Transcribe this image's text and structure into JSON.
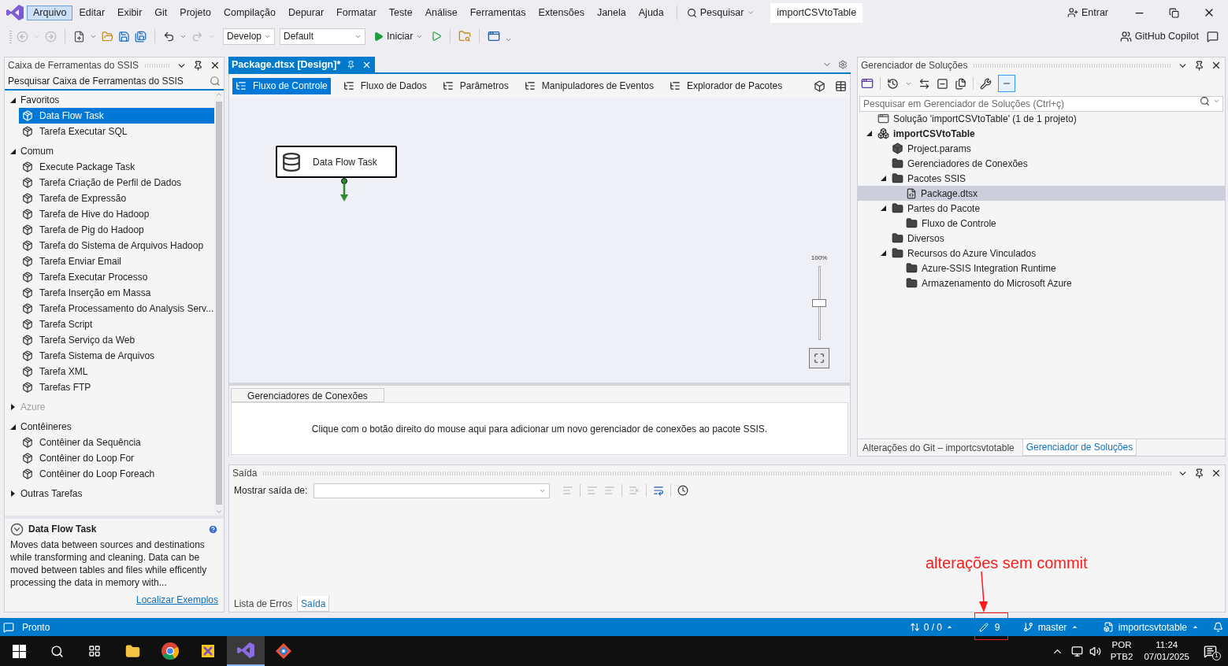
{
  "menu_bar": {
    "items": [
      {
        "label": "Arquivo",
        "selected": true
      },
      {
        "label": "Editar",
        "selected": false
      },
      {
        "label": "Exibir",
        "selected": false
      },
      {
        "label": "Git",
        "selected": false
      },
      {
        "label": "Projeto",
        "selected": false
      },
      {
        "label": "Compilação",
        "selected": false
      },
      {
        "label": "Depurar",
        "selected": false
      },
      {
        "label": "Formatar",
        "selected": false
      },
      {
        "label": "Teste",
        "selected": false
      },
      {
        "label": "Análise",
        "selected": false
      },
      {
        "label": "Ferramentas",
        "selected": false
      },
      {
        "label": "Extensões",
        "selected": false
      },
      {
        "label": "Janela",
        "selected": false
      },
      {
        "label": "Ajuda",
        "selected": false
      }
    ],
    "search": "Pesquisar",
    "solution_name": "importCSVtoTable",
    "sign_in": "Entrar"
  },
  "toolbar": {
    "configuration": "Develop",
    "platform": "Default",
    "start": "Iniciar",
    "copilot": "GitHub Copilot"
  },
  "toolbox": {
    "title": "Caixa de Ferramentas do SSIS",
    "search_placeholder": "Pesquisar Caixa de Ferramentas do SSIS",
    "groups": [
      {
        "label": "Favoritos",
        "expanded": true,
        "disabled": false,
        "children": [
          {
            "label": "Data Flow Task",
            "selected": true
          },
          {
            "label": "Tarefa Executar SQL",
            "selected": false
          }
        ]
      },
      {
        "label": "Comum",
        "expanded": true,
        "disabled": false,
        "children": [
          {
            "label": "Execute Package Task",
            "selected": false
          },
          {
            "label": "Tarefa Criação de Perfil de Dados",
            "selected": false
          },
          {
            "label": "Tarefa de Expressão",
            "selected": false
          },
          {
            "label": "Tarefa de Hive do Hadoop",
            "selected": false
          },
          {
            "label": "Tarefa de Pig do Hadoop",
            "selected": false
          },
          {
            "label": "Tarefa do Sistema de Arquivos Hadoop",
            "selected": false
          },
          {
            "label": "Tarefa Enviar Email",
            "selected": false
          },
          {
            "label": "Tarefa Executar Processo",
            "selected": false
          },
          {
            "label": "Tarefa Inserção em Massa",
            "selected": false
          },
          {
            "label": "Tarefa Processamento do Analysis Serv...",
            "selected": false
          },
          {
            "label": "Tarefa Script",
            "selected": false
          },
          {
            "label": "Tarefa Serviço da Web",
            "selected": false
          },
          {
            "label": "Tarefa Sistema de Arquivos",
            "selected": false
          },
          {
            "label": "Tarefa XML",
            "selected": false
          },
          {
            "label": "Tarefas FTP",
            "selected": false
          }
        ]
      },
      {
        "label": "Azure",
        "expanded": false,
        "disabled": true
      },
      {
        "label": "Contêineres",
        "expanded": true,
        "disabled": false,
        "children": [
          {
            "label": "Contêiner da Sequência",
            "selected": false
          },
          {
            "label": "Contêiner do Loop For",
            "selected": false
          },
          {
            "label": "Contêiner do Loop Foreach",
            "selected": false
          }
        ]
      },
      {
        "label": "Outras Tarefas",
        "expanded": false,
        "disabled": false
      }
    ]
  },
  "description": {
    "title": "Data Flow Task",
    "text": "Moves data between sources and destinations while transforming and cleaning. Data can be moved between tables and files while efficently processing the data in memory with...",
    "link": "Localizar Exemplos"
  },
  "document": {
    "tab": "Package.dtsx [Design]*",
    "design_tabs": [
      {
        "label": "Fluxo de Controle",
        "selected": true
      },
      {
        "label": "Fluxo de Dados",
        "selected": false
      },
      {
        "label": "Parâmetros",
        "selected": false
      },
      {
        "label": "Manipuladores de Eventos",
        "selected": false
      },
      {
        "label": "Explorador de Pacotes",
        "selected": false
      }
    ],
    "task": "Data Flow Task",
    "zoom_label": "100%",
    "zoom": {
      "level": 0.5
    },
    "connections": {
      "tab": "Gerenciadores de Conexões",
      "hint": "Clique com o botão direito do mouse aqui para adicionar um novo gerenciador de conexões ao pacote SSIS."
    }
  },
  "solution_explorer": {
    "title": "Gerenciador de Soluções",
    "search_placeholder": "Pesquisar em Gerenciador de Soluções (Ctrl+ç)",
    "tree": [
      {
        "kind": "solution",
        "label": "Solução 'importCSVtoTable' (1 de 1 projeto)",
        "selected": false
      },
      {
        "kind": "project",
        "label": "importCSVtoTable",
        "selected": false,
        "expanded": true,
        "children": [
          {
            "kind": "params",
            "label": "Project.params",
            "selected": false
          },
          {
            "kind": "folder",
            "label": "Gerenciadores de Conexões",
            "selected": false
          },
          {
            "kind": "folder",
            "label": "Pacotes SSIS",
            "selected": false,
            "expanded": true,
            "children": [
              {
                "kind": "file",
                "label": "Package.dtsx",
                "selected": true
              }
            ]
          },
          {
            "kind": "folder",
            "label": "Partes do Pacote",
            "selected": false,
            "expanded": true,
            "children": [
              {
                "kind": "folder",
                "label": "Fluxo de Controle",
                "selected": false
              }
            ]
          },
          {
            "kind": "folder",
            "label": "Diversos",
            "selected": false
          },
          {
            "kind": "folder",
            "label": "Recursos do Azure Vinculados",
            "selected": false,
            "expanded": true,
            "children": [
              {
                "kind": "folder",
                "label": "Azure-SSIS Integration Runtime",
                "selected": false
              },
              {
                "kind": "folder",
                "label": "Armazenamento do Microsoft Azure",
                "selected": false
              }
            ]
          }
        ]
      }
    ],
    "bottom_tabs": [
      {
        "label": "Alterações do Git – importcsvtotable",
        "selected": false
      },
      {
        "label": "Gerenciador de Soluções",
        "selected": true
      }
    ]
  },
  "output": {
    "title": "Saída",
    "show_label": "Mostrar saída de:",
    "tabs": [
      {
        "label": "Lista de Erros",
        "selected": false
      },
      {
        "label": "Saída",
        "selected": true
      }
    ]
  },
  "status_bar": {
    "status": "Pronto",
    "sync": "0 / 0",
    "changes": "9",
    "branch": "master",
    "repository": "importcsvtotable"
  },
  "taskbar": {
    "language": "POR",
    "layout": "PTB2",
    "time": "11:24",
    "date": "07/01/2025",
    "notifications": "1"
  },
  "annotation": {
    "text": "alterações sem commit"
  }
}
